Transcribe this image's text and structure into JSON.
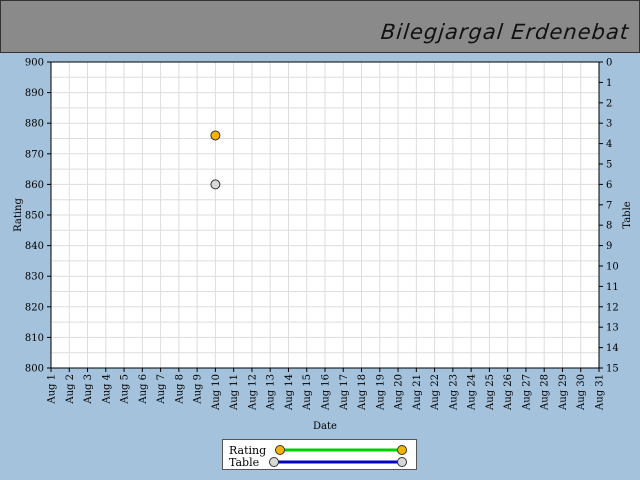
{
  "header": {
    "name": "Bilegjargal Erdenebat"
  },
  "colors": {
    "rating_point": "#f5b400",
    "table_point": "#d8d8d8",
    "rating_line": "#00d000",
    "table_line": "#0000c8",
    "grid": "#dddddd"
  },
  "chart_data": {
    "type": "scatter",
    "xlabel": "Date",
    "ylabel": "Rating",
    "y2label": "Table",
    "categories": [
      "Aug 1",
      "Aug 2",
      "Aug 3",
      "Aug 4",
      "Aug 5",
      "Aug 6",
      "Aug 7",
      "Aug 8",
      "Aug 9",
      "Aug 10",
      "Aug 11",
      "Aug 12",
      "Aug 13",
      "Aug 14",
      "Aug 15",
      "Aug 16",
      "Aug 17",
      "Aug 18",
      "Aug 19",
      "Aug 20",
      "Aug 21",
      "Aug 22",
      "Aug 23",
      "Aug 24",
      "Aug 25",
      "Aug 26",
      "Aug 27",
      "Aug 28",
      "Aug 29",
      "Aug 30",
      "Aug 31"
    ],
    "ylim": [
      800,
      900
    ],
    "yticks": [
      800,
      810,
      820,
      830,
      840,
      850,
      860,
      870,
      880,
      890,
      900
    ],
    "y2lim": [
      0,
      15
    ],
    "y2ticks": [
      0,
      1,
      2,
      3,
      4,
      5,
      6,
      7,
      8,
      9,
      10,
      11,
      12,
      13,
      14,
      15
    ],
    "y2_inverted": true,
    "grid": true,
    "legend_position": "bottom-center",
    "series": [
      {
        "name": "Rating",
        "axis": "left",
        "points": [
          {
            "x": "Aug 10",
            "y": 876
          }
        ]
      },
      {
        "name": "Table",
        "axis": "right",
        "points": [
          {
            "x": "Aug 10",
            "y": 6
          }
        ]
      }
    ]
  }
}
